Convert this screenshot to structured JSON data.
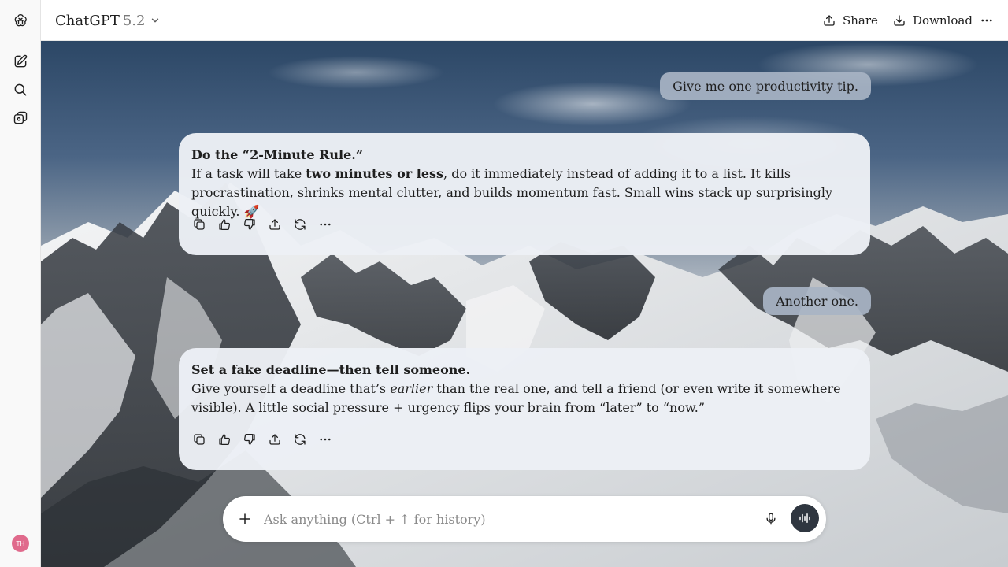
{
  "app": {
    "model_name": "ChatGPT",
    "model_version": "5.2"
  },
  "header": {
    "share_label": "Share",
    "download_label": "Download"
  },
  "sidebar": {
    "avatar_initials": "TH"
  },
  "conversation": [
    {
      "role": "user",
      "text": "Give me one productivity tip."
    },
    {
      "role": "assistant",
      "title": "Do the “2-Minute Rule.”",
      "body_pre": "If a task will take ",
      "body_bold": "two minutes or less",
      "body_post": ", do it immediately instead of adding it to a list. It kills procrastination, shrinks mental clutter, and builds momentum fast. Small wins stack up surprisingly quickly. 🚀"
    },
    {
      "role": "user",
      "text": "Another one."
    },
    {
      "role": "assistant",
      "title": "Set a fake deadline—then tell someone.",
      "body_pre": "Give yourself a deadline that’s ",
      "body_italic": "earlier",
      "body_post": " than the real one, and tell a friend (or even write it somewhere visible). A little social pressure + urgency flips your brain from “later” to “now.”"
    }
  ],
  "composer": {
    "placeholder": "Ask anything (Ctrl + ↑ for history)"
  },
  "icons": {
    "sidebar": [
      "openai-logo-icon",
      "new-chat-icon",
      "search-icon",
      "library-icon"
    ],
    "message_actions": [
      "copy-icon",
      "thumbs-up-icon",
      "thumbs-down-icon",
      "share-icon",
      "regenerate-icon",
      "more-icon"
    ]
  },
  "colors": {
    "user_bubble": "#a8b4c4",
    "assistant_bubble": "#eceff5",
    "voice_button": "#2f3640",
    "avatar": "#e06a8c"
  }
}
